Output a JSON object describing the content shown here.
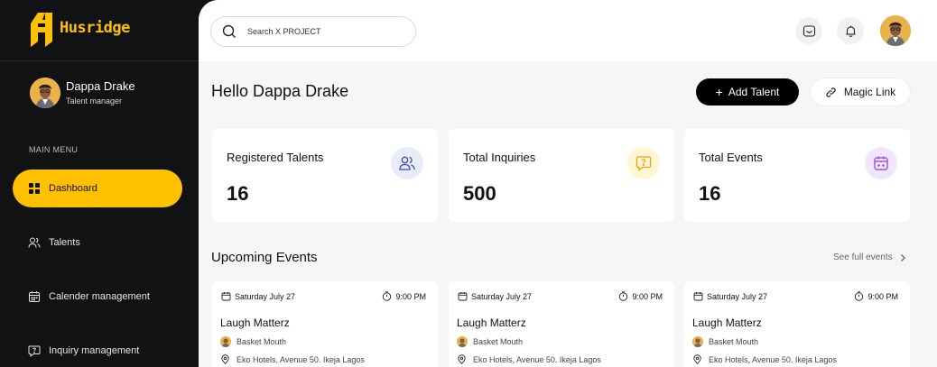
{
  "brand": {
    "name": "Husridge",
    "accent": "#FFC000"
  },
  "sidebar": {
    "profile": {
      "name": "Dappa Drake",
      "role": "Talent manager"
    },
    "menu_heading": "MAIN MENU",
    "items": [
      {
        "label": "Dashboard",
        "icon": "dashboard-grid-icon",
        "active": true
      },
      {
        "label": "Talents",
        "icon": "users-icon",
        "active": false
      },
      {
        "label": "Calender management",
        "icon": "calendar-icon",
        "active": false
      },
      {
        "label": "Inquiry management",
        "icon": "chat-question-icon",
        "active": false
      }
    ]
  },
  "topbar": {
    "search_placeholder": "Search X PROJECT",
    "icons": [
      "search-icon",
      "inbox-icon",
      "bell-icon",
      "avatar"
    ]
  },
  "header": {
    "greeting": "Hello Dappa Drake",
    "add_label": "Add Talent",
    "magic_label": "Magic Link"
  },
  "stats": [
    {
      "label": "Registered Talents",
      "value": "16",
      "icon": "users-icon",
      "color": "#3A4BB5",
      "bg": "#E8EBF8"
    },
    {
      "label": "Total Inquiries",
      "value": "500",
      "icon": "chat-question-icon",
      "color": "#E8A800",
      "bg": "#FFF6D6"
    },
    {
      "label": "Total Events",
      "value": "16",
      "icon": "calendar-icon",
      "color": "#9B3FD8",
      "bg": "#F1E6FB"
    }
  ],
  "events_section": {
    "title": "Upcoming Events",
    "see_full": "See full events"
  },
  "events": [
    {
      "date": "Saturday July 27",
      "time": "9:00 PM",
      "title": "Laugh Matterz",
      "artist": "Basket Mouth",
      "location": "Eko Hotels, Avenue 50. Ikeja Lagos"
    },
    {
      "date": "Saturday July 27",
      "time": "9:00 PM",
      "title": "Laugh Matterz",
      "artist": "Basket Mouth",
      "location": "Eko Hotels, Avenue 50. Ikeja Lagos"
    },
    {
      "date": "Saturday July 27",
      "time": "9:00 PM",
      "title": "Laugh Matterz",
      "artist": "Basket Mouth",
      "location": "Eko Hotels, Avenue 50. Ikeja Lagos"
    }
  ]
}
